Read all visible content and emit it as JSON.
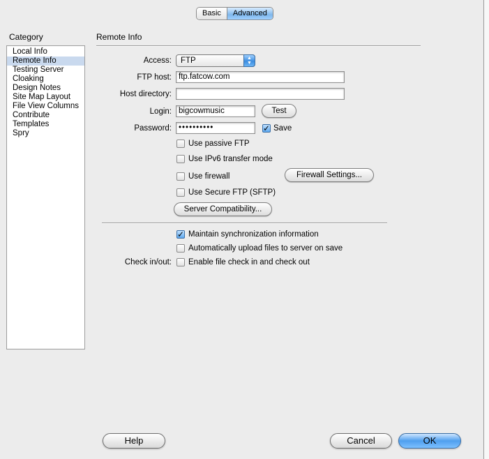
{
  "tabs": [
    {
      "label": "Basic",
      "selected": false
    },
    {
      "label": "Advanced",
      "selected": true
    }
  ],
  "sidebar": {
    "title": "Category",
    "items": [
      {
        "label": "Local Info",
        "selected": false
      },
      {
        "label": "Remote Info",
        "selected": true
      },
      {
        "label": "Testing Server",
        "selected": false
      },
      {
        "label": "Cloaking",
        "selected": false
      },
      {
        "label": "Design Notes",
        "selected": false
      },
      {
        "label": "Site Map Layout",
        "selected": false
      },
      {
        "label": "File View Columns",
        "selected": false
      },
      {
        "label": "Contribute",
        "selected": false
      },
      {
        "label": "Templates",
        "selected": false
      },
      {
        "label": "Spry",
        "selected": false
      }
    ]
  },
  "main": {
    "section_title": "Remote Info",
    "access": {
      "label": "Access:",
      "value": "FTP"
    },
    "ftp_host": {
      "label": "FTP host:",
      "value": "ftp.fatcow.com"
    },
    "host_directory": {
      "label": "Host directory:",
      "value": ""
    },
    "login": {
      "label": "Login:",
      "value": "bigcowmusic",
      "test_label": "Test"
    },
    "password": {
      "label": "Password:",
      "value": "••••••••••",
      "save_label": "Save",
      "save_checked": true
    },
    "options": {
      "passive_ftp": {
        "label": "Use passive FTP",
        "checked": false
      },
      "ipv6": {
        "label": "Use IPv6 transfer mode",
        "checked": false
      },
      "firewall": {
        "label": "Use firewall",
        "checked": false
      },
      "firewall_settings_label": "Firewall Settings...",
      "sftp": {
        "label": "Use Secure FTP (SFTP)",
        "checked": false
      },
      "server_compat_label": "Server Compatibility..."
    },
    "sync": {
      "label": "Maintain synchronization information",
      "checked": true
    },
    "auto_upload": {
      "label": "Automatically upload files to server on save",
      "checked": false
    },
    "checkinout": {
      "label": "Check in/out:",
      "enable_label": "Enable file check in and check out",
      "checked": false
    }
  },
  "footer": {
    "help_label": "Help",
    "cancel_label": "Cancel",
    "ok_label": "OK"
  }
}
